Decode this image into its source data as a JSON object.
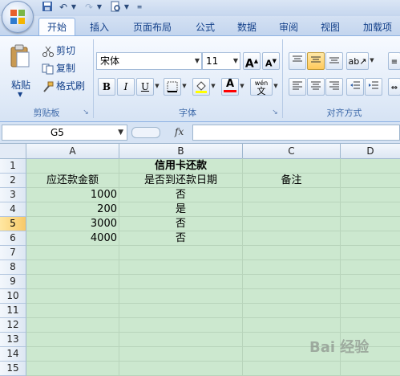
{
  "quick_access": {
    "save_icon": "save-icon",
    "undo_icon": "undo-icon",
    "redo_icon": "redo-icon",
    "preview_icon": "print-preview-icon"
  },
  "tabs": [
    "开始",
    "插入",
    "页面布局",
    "公式",
    "数据",
    "审阅",
    "视图",
    "加载项"
  ],
  "ribbon": {
    "clipboard": {
      "paste": "粘贴",
      "cut": "剪切",
      "copy": "复制",
      "format_painter": "格式刷",
      "group_label": "剪贴板"
    },
    "font": {
      "font_name": "宋体",
      "font_size": "11",
      "grow": "A",
      "shrink": "A",
      "bold": "B",
      "italic": "I",
      "underline": "U",
      "font_color_glyph": "A",
      "phonetic": "wén",
      "phonetic_char": "文",
      "group_label": "字体"
    },
    "alignment": {
      "group_label": "对齐方式"
    },
    "colors": {
      "fill": "#ffff00",
      "font_color": "#ff0000",
      "sheet_bg": "#cce8cf"
    }
  },
  "formula_bar": {
    "name_box": "G5",
    "fx": "fx",
    "content": ""
  },
  "sheet": {
    "columns": [
      "A",
      "B",
      "C",
      "D"
    ],
    "rows": [
      "1",
      "2",
      "3",
      "4",
      "5",
      "6",
      "7",
      "8",
      "9",
      "10",
      "11",
      "12",
      "13",
      "14",
      "15"
    ],
    "selected_row": "5",
    "cells": {
      "b1": "信用卡还款",
      "a2": "应还款金额",
      "b2": "是否到还款日期",
      "c2": "备注",
      "a3": "1000",
      "b3": "否",
      "a4": "200",
      "b4": "是",
      "a5": "3000",
      "b5": "否",
      "a6": "4000",
      "b6": "否"
    }
  },
  "watermark": "Bai 经验"
}
